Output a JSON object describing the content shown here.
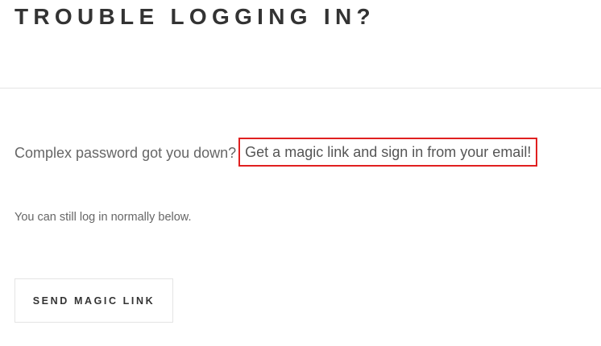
{
  "header": {
    "title": "TROUBLE LOGGING IN?"
  },
  "intro": {
    "question": "Complex password got you down?",
    "link_text": "Get a magic link and sign in from your email!"
  },
  "secondary": {
    "text": "You can still log in normally below."
  },
  "actions": {
    "send_label": "SEND MAGIC LINK"
  },
  "colors": {
    "highlight_outline": "#e02020",
    "divider": "#e4e4e4",
    "text": "#555555"
  }
}
